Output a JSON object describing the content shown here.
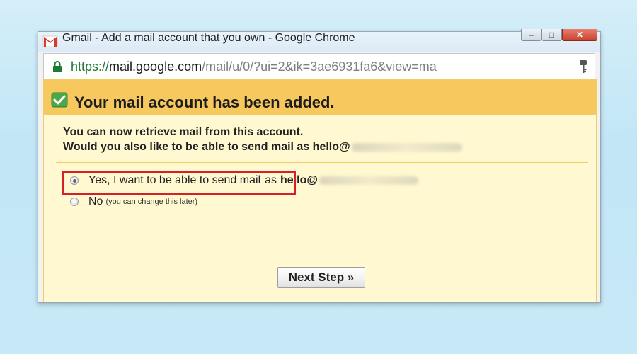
{
  "window": {
    "title": "Gmail - Add a mail account that you own - Google Chrome",
    "controls": {
      "minimize": "–",
      "maximize": "□",
      "close": "✕"
    },
    "icon": "gmail-icon"
  },
  "address_bar": {
    "url_scheme": "https://",
    "url_host": "mail.google.com",
    "url_path": "/mail/u/0/?ui=2&ik=3ae6931fa6&view=ma",
    "icons": [
      "lock-icon",
      "key-icon"
    ],
    "secure_color": "#1d7a33"
  },
  "banner": {
    "title": "Your mail account has been added.",
    "icon": "check-icon",
    "background": "#f7c85e"
  },
  "message": {
    "line1": "You can now retrieve mail from this account.",
    "line2": "Would you also like to be able to send mail as hello@"
  },
  "options": {
    "yes_label": "Yes, I want to be able to send mail",
    "yes_suffix": "as",
    "yes_email": "hello@",
    "yes_selected": true,
    "no_label": "No",
    "no_note": "(you can change this later)",
    "no_selected": false
  },
  "next_button": {
    "label": "Next Step »"
  },
  "colors": {
    "page_bg": "#fff8d0",
    "highlight": "#d42027"
  }
}
